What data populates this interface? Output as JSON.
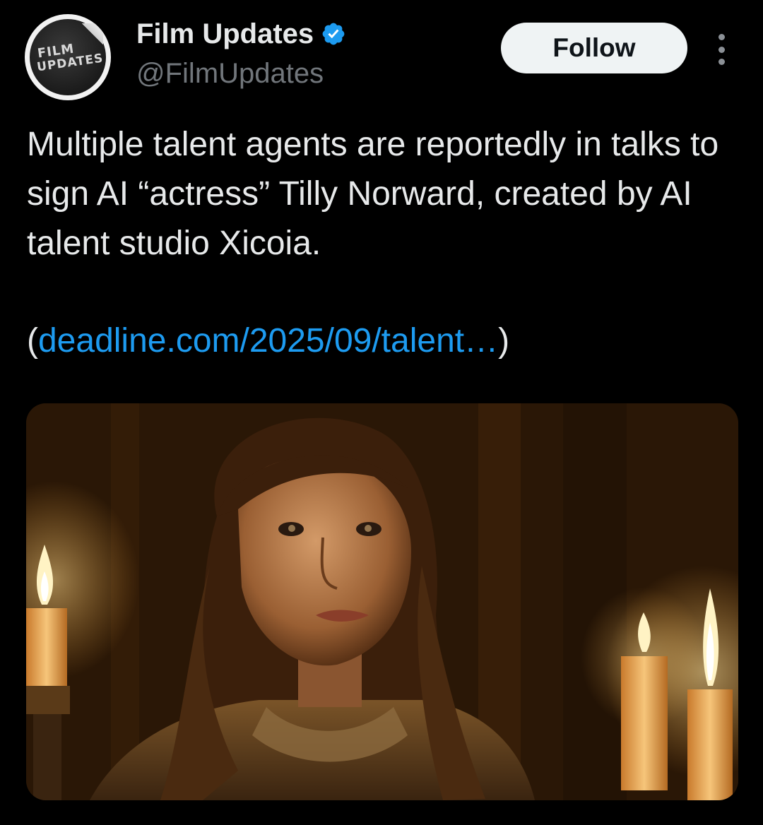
{
  "author": {
    "display_name": "Film Updates",
    "handle": "@FilmUpdates",
    "verified": true,
    "avatar_text_line1": "FILM",
    "avatar_text_line2": "UPDATES"
  },
  "actions": {
    "follow_label": "Follow",
    "more_icon": "more-vertical-icon"
  },
  "tweet": {
    "text": "Multiple talent agents are reportedly in talks to sign AI “actress” Tilly Norward, created by AI talent studio Xicoia.",
    "link_open": "(",
    "link_text": "deadline.com/2025/09/talent…",
    "link_close": ")"
  },
  "colors": {
    "background": "#000000",
    "text_primary": "#e7e9ea",
    "text_secondary": "#71767b",
    "link": "#1d9bf0",
    "verified_badge": "#1d9bf0",
    "follow_button_bg": "#eff3f4"
  }
}
